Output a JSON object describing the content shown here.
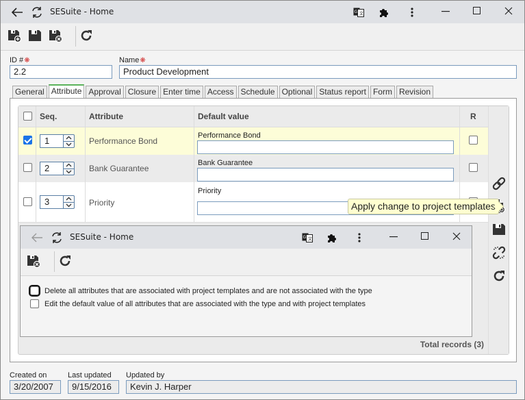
{
  "window": {
    "title": "SESuite - Home",
    "icons": [
      "back-arrow-icon",
      "reload-icon",
      "translate-icon",
      "extension-puzzle-icon",
      "more-vertical-icon",
      "minimize-icon",
      "maximize-icon",
      "close-icon"
    ]
  },
  "toolbar": {
    "buttons": [
      {
        "name": "save-and-new",
        "icon": "save-plus-icon"
      },
      {
        "name": "save",
        "icon": "save-icon"
      },
      {
        "name": "save-and-close",
        "icon": "save-close-icon"
      },
      {
        "name": "refresh",
        "icon": "refresh-icon"
      }
    ]
  },
  "form": {
    "id_label": "ID #",
    "id_value": "2.2",
    "name_label": "Name",
    "name_value": "Product Development",
    "required_mark": "❋"
  },
  "tabs": [
    {
      "label": "General",
      "active": false
    },
    {
      "label": "Attribute",
      "active": true
    },
    {
      "label": "Approval",
      "active": false
    },
    {
      "label": "Closure",
      "active": false
    },
    {
      "label": "Enter time",
      "active": false
    },
    {
      "label": "Access",
      "active": false
    },
    {
      "label": "Schedule",
      "active": false
    },
    {
      "label": "Optional",
      "active": false
    },
    {
      "label": "Status report",
      "active": false
    },
    {
      "label": "Form",
      "active": false
    },
    {
      "label": "Revision",
      "active": false
    }
  ],
  "grid": {
    "columns": {
      "seq": "Seq.",
      "attribute": "Attribute",
      "default_value": "Default value",
      "r": "R"
    },
    "rows": [
      {
        "checked": true,
        "seq": "1",
        "attribute": "Performance Bond",
        "default_label": "Performance Bond",
        "default_value": "",
        "r": false
      },
      {
        "checked": false,
        "seq": "2",
        "attribute": "Bank Guarantee",
        "default_label": "Bank Guarantee",
        "default_value": "",
        "r": false
      },
      {
        "checked": false,
        "seq": "3",
        "attribute": "Priority",
        "default_label": "Priority",
        "default_value": "",
        "r": false
      }
    ],
    "total_records": "Total records (3)",
    "side_buttons": [
      "link-icon",
      "apply-to-templates-icon",
      "save-icon",
      "unlink-icon",
      "refresh-icon"
    ]
  },
  "tooltip": {
    "text": "Apply change to project templates"
  },
  "dialog": {
    "title": "SESuite - Home",
    "options": [
      {
        "label": "Delete all attributes that are associated with project templates and are not associated with the type",
        "checked": false
      },
      {
        "label": "Edit the default value of all attributes that are associated with the type and with project templates",
        "checked": false
      }
    ]
  },
  "meta": {
    "created_on_label": "Created on",
    "created_on": "3/20/2007",
    "last_updated_label": "Last updated",
    "last_updated": "9/15/2016",
    "updated_by_label": "Updated by",
    "updated_by": "Kevin J. Harper"
  },
  "colors": {
    "accent_green": "#5bb35b",
    "checkbox_blue": "#1a73e8",
    "selected_row": "#fdfdd8",
    "required_red": "#d03030",
    "tooltip_bg": "#ffffd0"
  }
}
